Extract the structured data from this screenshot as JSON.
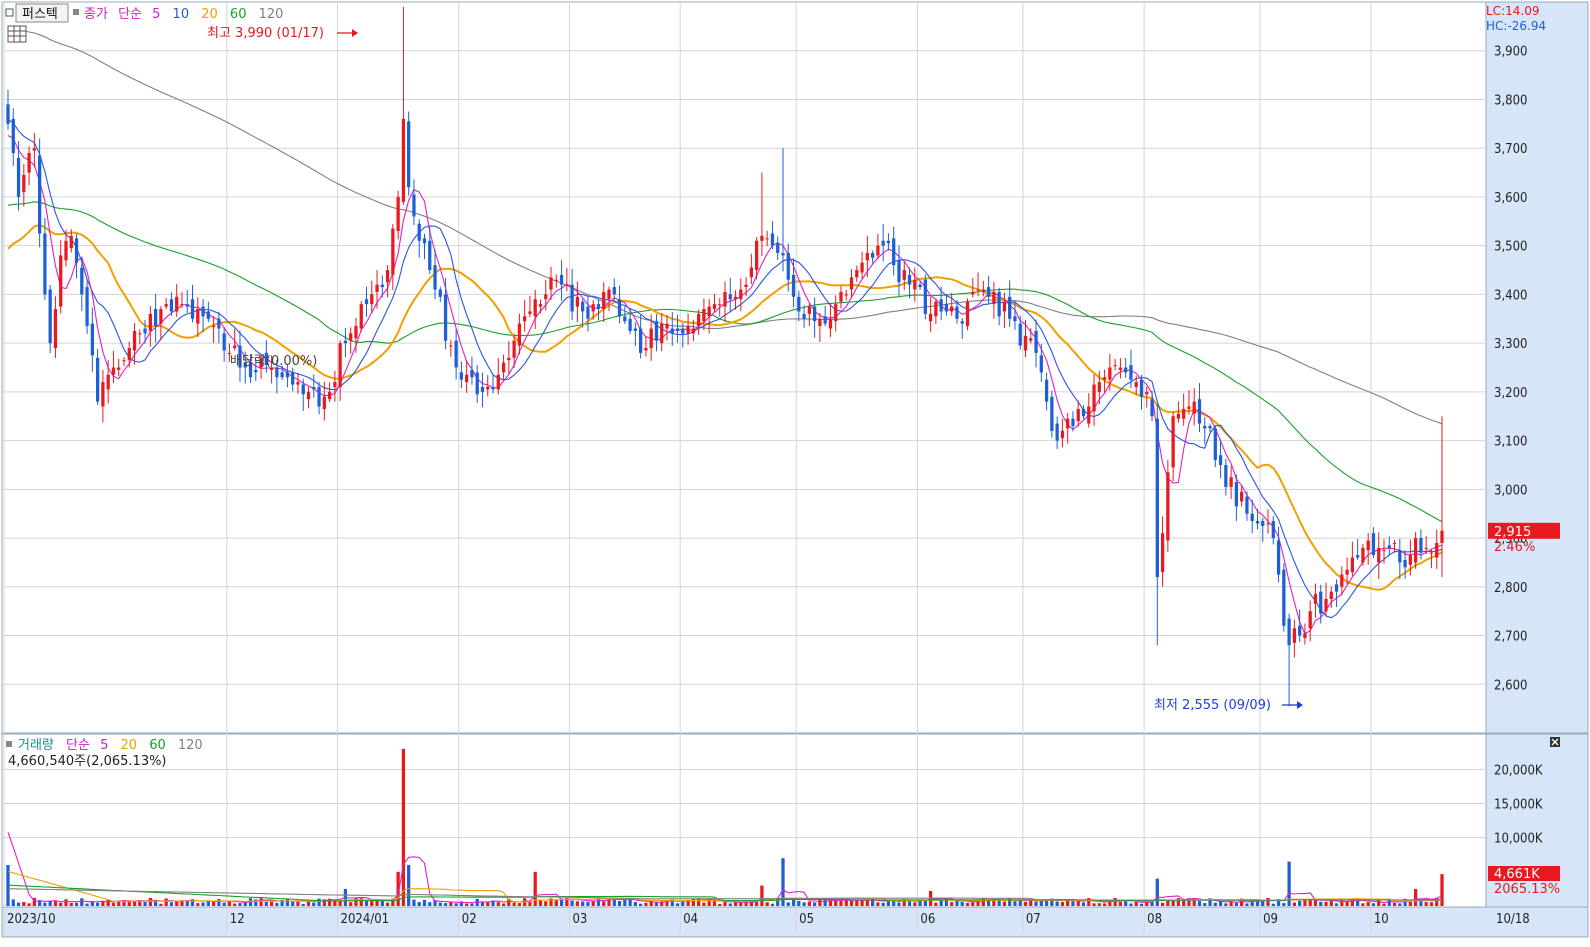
{
  "price_panel": {
    "legend": {
      "tab_label": "퍼스텍",
      "price_label": "종가",
      "ma_type": "단순",
      "ma_periods": [
        "5",
        "10",
        "20",
        "60",
        "120"
      ]
    },
    "high_marker": "최고 3,990 (01/17)",
    "low_marker": "최저 2,555 (09/09)",
    "dividend_label": "배당락(0.00%)",
    "lc_label": "LC:14.09",
    "hc_label": "HC:-26.94",
    "last_price_label": "2,915",
    "last_change_label": "2.46%"
  },
  "volume_panel": {
    "legend": {
      "title": "거래량",
      "ma_type": "단순",
      "ma_periods": [
        "5",
        "20",
        "60",
        "120"
      ]
    },
    "summary": "4,660,540주(2,065.13%)",
    "last_volume_label": "4,661K",
    "last_ratio_label": "2065.13%"
  },
  "colors": {
    "up": "#e8191f",
    "down": "#1e5fd6",
    "ma5": "#e020c8",
    "ma10": "#2a55e0",
    "ma20": "#f0a000",
    "ma60": "#18a028",
    "ma120": "#808080",
    "axis_bg": "#d6e6f8",
    "grid": "#d4d4d4"
  },
  "chart_data": {
    "type": "candlestick",
    "price_axis": {
      "ylim": [
        2500,
        4000
      ],
      "ticks": [
        2600,
        2700,
        2800,
        2900,
        3000,
        3100,
        3200,
        3300,
        3400,
        3500,
        3600,
        3700,
        3800,
        3900
      ],
      "tick_labels": [
        "2,600",
        "2,700",
        "2,800",
        "2,900",
        "3,000",
        "3,100",
        "3,200",
        "3,300",
        "3,400",
        "3,500",
        "3,600",
        "3,700",
        "3,800",
        "3,900"
      ]
    },
    "volume_axis": {
      "ylim": [
        0,
        24000
      ],
      "ticks": [
        10000,
        15000,
        20000
      ],
      "tick_labels": [
        "10,000K",
        "15,000K",
        "20,000K"
      ]
    },
    "x_axis": {
      "labels": [
        "2023/10",
        "12",
        "2024/01",
        "02",
        "03",
        "04",
        "05",
        "06",
        "07",
        "08",
        "09",
        "10"
      ],
      "end_label": "10/18"
    },
    "keyframes": [
      {
        "d": "2023-10-04",
        "c": 3750,
        "v": 6000
      },
      {
        "d": "2023-10-06",
        "c": 3600
      },
      {
        "d": "2023-10-11",
        "c": 3700
      },
      {
        "d": "2023-10-13",
        "c": 3400
      },
      {
        "d": "2023-10-16",
        "c": 3300
      },
      {
        "d": "2023-10-18",
        "c": 3480
      },
      {
        "d": "2023-10-20",
        "c": 3520
      },
      {
        "d": "2023-10-24",
        "c": 3400
      },
      {
        "d": "2023-10-27",
        "c": 3180
      },
      {
        "d": "2023-11-01",
        "c": 3250
      },
      {
        "d": "2023-11-08",
        "c": 3320
      },
      {
        "d": "2023-11-15",
        "c": 3380
      },
      {
        "d": "2023-11-22",
        "c": 3350
      },
      {
        "d": "2023-11-29",
        "c": 3330
      },
      {
        "d": "2023-12-06",
        "c": 3250
      },
      {
        "d": "2023-12-13",
        "c": 3250
      },
      {
        "d": "2023-12-20",
        "c": 3220
      },
      {
        "d": "2023-12-27",
        "c": 3190
      },
      {
        "d": "2024-01-02",
        "c": 3300,
        "v": 2500
      },
      {
        "d": "2024-01-05",
        "c": 3380
      },
      {
        "d": "2024-01-10",
        "c": 3420
      },
      {
        "d": "2024-01-12",
        "c": 3450
      },
      {
        "d": "2024-01-16",
        "c": 3600,
        "v": 5000
      },
      {
        "d": "2024-01-17",
        "c": 3760,
        "h": 3990,
        "v": 23000
      },
      {
        "d": "2024-01-18",
        "c": 3620,
        "v": 6000
      },
      {
        "d": "2024-01-19",
        "c": 3560
      },
      {
        "d": "2024-01-24",
        "c": 3450
      },
      {
        "d": "2024-01-31",
        "c": 3250
      },
      {
        "d": "2024-02-07",
        "c": 3200
      },
      {
        "d": "2024-02-14",
        "c": 3270
      },
      {
        "d": "2024-02-21",
        "c": 3390,
        "v": 5000
      },
      {
        "d": "2024-02-28",
        "c": 3420
      },
      {
        "d": "2024-03-06",
        "c": 3350
      },
      {
        "d": "2024-03-13",
        "c": 3400
      },
      {
        "d": "2024-03-20",
        "c": 3280
      },
      {
        "d": "2024-03-27",
        "c": 3340
      },
      {
        "d": "2024-04-03",
        "c": 3330
      },
      {
        "d": "2024-04-10",
        "c": 3380
      },
      {
        "d": "2024-04-17",
        "c": 3420
      },
      {
        "d": "2024-04-22",
        "c": 3520,
        "h": 3650,
        "v": 3000
      },
      {
        "d": "2024-04-26",
        "c": 3480,
        "h": 3700,
        "v": 7000
      },
      {
        "d": "2024-05-02",
        "c": 3350
      },
      {
        "d": "2024-05-09",
        "c": 3350
      },
      {
        "d": "2024-05-16",
        "c": 3450
      },
      {
        "d": "2024-05-23",
        "c": 3500
      },
      {
        "d": "2024-05-30",
        "c": 3420
      },
      {
        "d": "2024-06-05",
        "c": 3360,
        "v": 2200
      },
      {
        "d": "2024-06-12",
        "c": 3350
      },
      {
        "d": "2024-06-19",
        "c": 3410
      },
      {
        "d": "2024-06-26",
        "c": 3350
      },
      {
        "d": "2024-07-03",
        "c": 3280
      },
      {
        "d": "2024-07-09",
        "c": 3100
      },
      {
        "d": "2024-07-16",
        "c": 3150
      },
      {
        "d": "2024-07-23",
        "c": 3250
      },
      {
        "d": "2024-07-30",
        "c": 3220
      },
      {
        "d": "2024-08-02",
        "c": 3150
      },
      {
        "d": "2024-08-05",
        "c": 2820,
        "l": 2680,
        "v": 4000
      },
      {
        "d": "2024-08-08",
        "c": 3150
      },
      {
        "d": "2024-08-14",
        "c": 3180
      },
      {
        "d": "2024-08-21",
        "c": 3050
      },
      {
        "d": "2024-08-28",
        "c": 2950
      },
      {
        "d": "2024-09-04",
        "c": 2900
      },
      {
        "d": "2024-09-06",
        "c": 2720
      },
      {
        "d": "2024-09-09",
        "c": 2680,
        "l": 2555,
        "v": 6500
      },
      {
        "d": "2024-09-11",
        "c": 2700
      },
      {
        "d": "2024-09-13",
        "c": 2750
      },
      {
        "d": "2024-09-20",
        "c": 2790
      },
      {
        "d": "2024-09-27",
        "c": 2880
      },
      {
        "d": "2024-10-04",
        "c": 2880
      },
      {
        "d": "2024-10-08",
        "c": 2850
      },
      {
        "d": "2024-10-11",
        "c": 2900,
        "v": 2500
      },
      {
        "d": "2024-10-15",
        "c": 2880
      },
      {
        "d": "2024-10-18",
        "c": 2915,
        "h": 3150,
        "l": 2820,
        "v": 4661
      }
    ],
    "ma_start": {
      "ma5": 3720,
      "ma10": 3760,
      "ma20": 3480,
      "ma60": 3580,
      "ma120": 3950
    }
  }
}
